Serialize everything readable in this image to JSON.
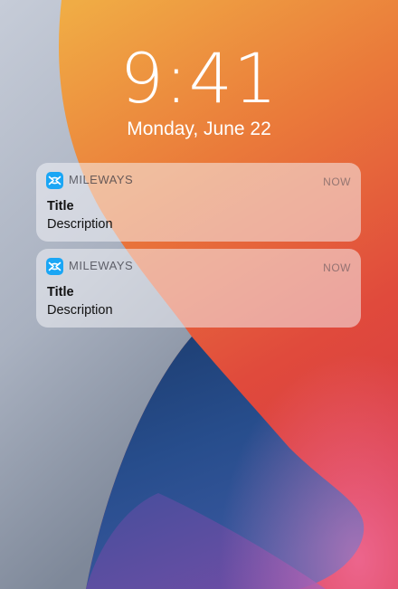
{
  "lock_screen": {
    "time": "9:41",
    "date": "Monday, June 22"
  },
  "notifications": [
    {
      "app_name": "MILEWAYS",
      "app_icon": "mileways-logo-icon",
      "time": "NOW",
      "title": "Title",
      "description": "Description"
    },
    {
      "app_name": "MILEWAYS",
      "app_icon": "mileways-logo-icon",
      "time": "NOW",
      "title": "Title",
      "description": "Description"
    }
  ],
  "colors": {
    "app_icon_background": "#1aa6f5",
    "wallpaper_orange": "#f0a040",
    "wallpaper_red": "#dc3c3c",
    "wallpaper_blue": "#224a82",
    "wallpaper_gray": "#b8c0d0"
  }
}
